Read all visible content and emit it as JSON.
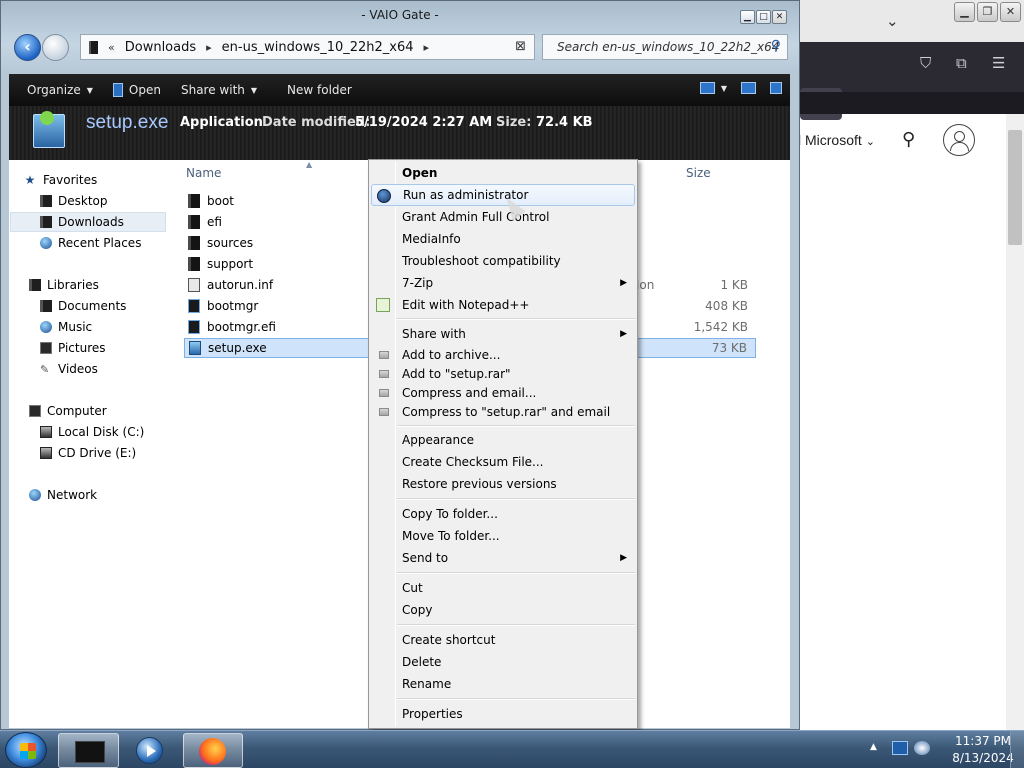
{
  "browser": {
    "header_text": "l Microsoft"
  },
  "explorer": {
    "title": "- VAIO Gate -",
    "breadcrumb_overflow": "«",
    "breadcrumb": [
      "Downloads",
      "en-us_windows_10_22h2_x64"
    ],
    "search_placeholder": "Search en-us_windows_10_22h2_x64",
    "commands": [
      "Organize",
      "Open",
      "Share with",
      "New folder"
    ],
    "details": {
      "filename": "setup.exe",
      "type": "Application",
      "date_label": "Date modified:",
      "date_value": "5/19/2024 2:27 AM",
      "size_label": "Size:",
      "size_value": "72.4 KB"
    },
    "nav": {
      "favorites": "Favorites",
      "desktop": "Desktop",
      "downloads": "Downloads",
      "recent": "Recent Places",
      "libraries": "Libraries",
      "documents": "Documents",
      "music": "Music",
      "pictures": "Pictures",
      "videos": "Videos",
      "computer": "Computer",
      "local_disk": "Local Disk (C:)",
      "cd_drive": "CD Drive (E:)",
      "network": "Network"
    },
    "columns": {
      "name": "Name",
      "size": "Size"
    },
    "files": [
      {
        "name": "boot",
        "type": "",
        "size": ""
      },
      {
        "name": "efi",
        "type": "",
        "size": ""
      },
      {
        "name": "sources",
        "type": "",
        "size": ""
      },
      {
        "name": "support",
        "type": "",
        "size": ""
      },
      {
        "name": "autorun.inf",
        "type": "ation",
        "size": "1 KB"
      },
      {
        "name": "bootmgr",
        "type": "",
        "size": "408 KB"
      },
      {
        "name": "bootmgr.efi",
        "type": "",
        "size": "1,542 KB"
      },
      {
        "name": "setup.exe",
        "type": "",
        "size": "73 KB"
      }
    ]
  },
  "context_menu": {
    "open": "Open",
    "run_as_admin": "Run as administrator",
    "grant_admin": "Grant Admin Full Control",
    "mediainfo": "MediaInfo",
    "troubleshoot": "Troubleshoot compatibility",
    "seven_zip": "7-Zip",
    "notepadpp": "Edit with Notepad++",
    "share_with": "Share with",
    "add_archive": "Add to archive...",
    "add_rar": "Add to \"setup.rar\"",
    "compress_email": "Compress and email...",
    "compress_rar_email": "Compress to \"setup.rar\" and email",
    "appearance": "Appearance",
    "checksum": "Create Checksum File...",
    "restore": "Restore previous versions",
    "copy_to": "Copy To folder...",
    "move_to": "Move To folder...",
    "send_to": "Send to",
    "cut": "Cut",
    "copy": "Copy",
    "create_shortcut": "Create shortcut",
    "delete": "Delete",
    "rename": "Rename",
    "properties": "Properties"
  },
  "taskbar": {
    "time": "11:37 PM",
    "date": "8/13/2024"
  }
}
